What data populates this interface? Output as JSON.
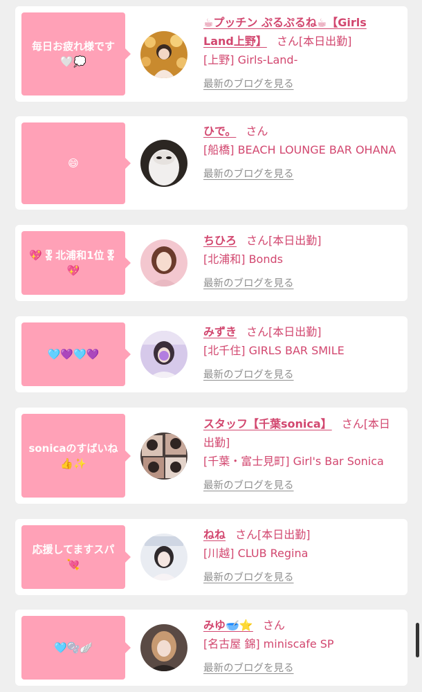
{
  "colors": {
    "bubble": "#ffa1b7",
    "name": "#d2476f",
    "link": "#8f8f8f",
    "background": "#efefef"
  },
  "icons": [
    "avatar-photo",
    "speech-bubble-tail"
  ],
  "cards": [
    {
      "message": "毎日お疲れ様です 🤍💭",
      "name": "☕プッチン ぷるぷるね☕【Girls Land上野】",
      "status": "さん[本日出勤]",
      "shop": "[上野] Girls-Land-",
      "blog": "最新のブログを見る"
    },
    {
      "message": "😄",
      "name": "ひで。",
      "status": "さん",
      "shop": "[船橋] BEACH LOUNGE BAR OHANA",
      "blog": "最新のブログを見る"
    },
    {
      "message": "💖🎖北浦和1位🎖💖",
      "name": "ちひろ",
      "status": "さん[本日出勤]",
      "shop": "[北浦和] Bonds",
      "blog": "最新のブログを見る"
    },
    {
      "message": "🩵💜🩵💜",
      "name": "みずき",
      "status": "さん[本日出勤]",
      "shop": "[北千住] GIRLS BAR SMILE",
      "blog": "最新のブログを見る"
    },
    {
      "message": "sonicaのすばいね👍✨",
      "name": "スタッフ【千葉sonica】",
      "status": "さん[本日出勤]",
      "shop": "[千葉・富士見町] Girl's Bar Sonica",
      "blog": "最新のブログを見る"
    },
    {
      "message": "応援してますスパ💘",
      "name": "ねね",
      "status": "さん[本日出勤]",
      "shop": "[川越] CLUB Regina",
      "blog": "最新のブログを見る"
    },
    {
      "message": "🩵🫧🪽",
      "name": "みゆ🥣⭐",
      "status": "さん",
      "shop": "[名古屋 錦] miniscafe SP",
      "blog": "最新のブログを見る"
    }
  ]
}
